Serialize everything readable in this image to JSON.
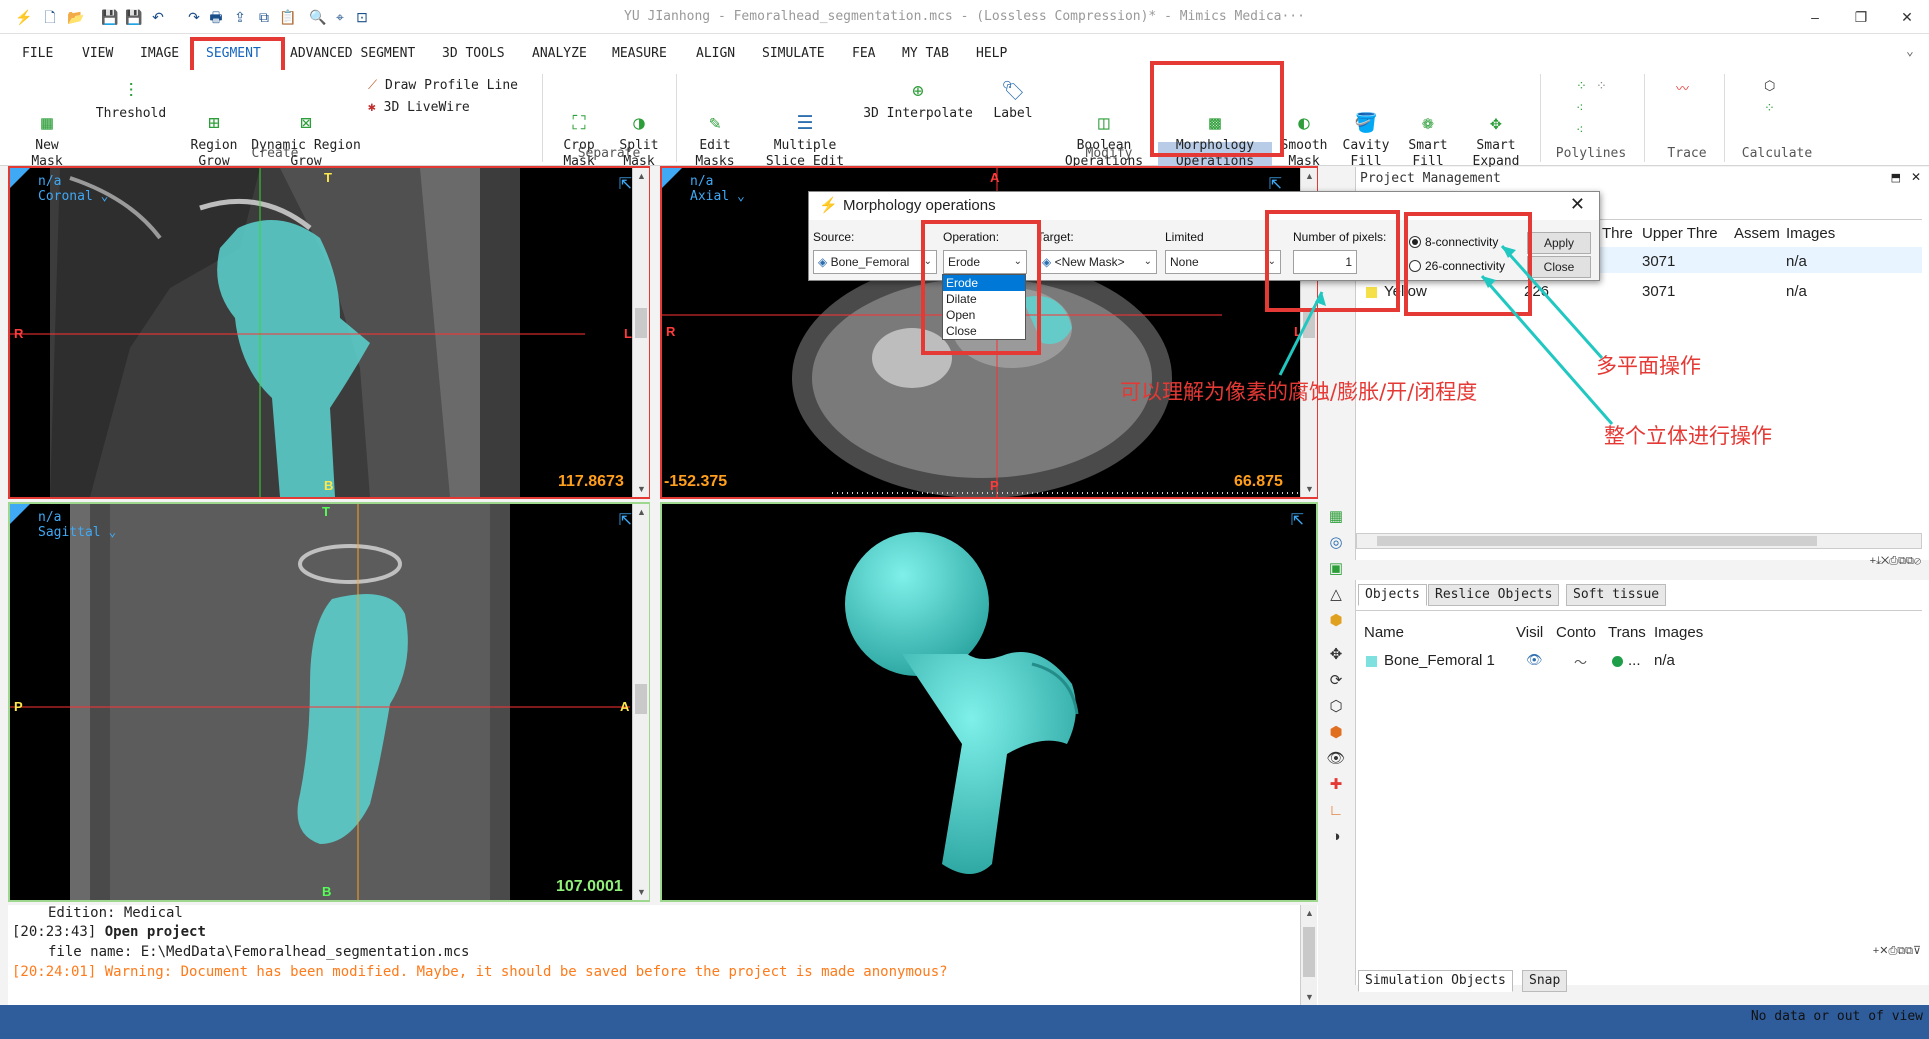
{
  "titlebar": {
    "title": "YU JIanhong - Femoralhead_segmentation.mcs -  (Lossless Compression)* - Mimics Medica···",
    "minimize": "–",
    "restore": "❐",
    "close": "✕"
  },
  "menu": [
    "FILE",
    "VIEW",
    "IMAGE",
    "SEGMENT",
    "ADVANCED SEGMENT",
    "3D TOOLS",
    "ANALYZE",
    "MEASURE",
    "ALIGN",
    "SIMULATE",
    "FEA",
    "MY TAB",
    "HELP"
  ],
  "ribbon": {
    "new_mask": "New\nMask",
    "threshold": "Threshold",
    "region_grow": "Region\nGrow",
    "dynamic_region_grow": "Dynamic Region\nGrow",
    "draw_profile_line": "Draw Profile Line",
    "live_wire": "3D LiveWire",
    "group_create": "Create",
    "crop_mask": "Crop\nMask",
    "split_mask": "Split\nMask",
    "group_separate": "Separate",
    "edit_masks": "Edit\nMasks",
    "multiple_slice_edit": "Multiple\nSlice Edit",
    "interpolate_3d": "3D Interpolate",
    "label": "Label",
    "boolean_operations": "Boolean\nOperations",
    "morphology_operations": "Morphology\nOperations",
    "smooth_mask": "Smooth\nMask",
    "cavity_fill": "Cavity\nFill",
    "smart_fill": "Smart\nFill",
    "smart_expand": "Smart\nExpand",
    "group_modify": "Modify",
    "group_polylines": "Polylines",
    "group_trace": "Trace",
    "group_calculate": "Calculate"
  },
  "viewports": {
    "coronal": {
      "name": "n/a",
      "view": "Coronal",
      "value": "117.8673",
      "top": "T",
      "bottom": "B",
      "left": "R",
      "right": "L"
    },
    "axial": {
      "name": "n/a",
      "view": "Axial",
      "value_left": "-152.375",
      "value_right": "66.875",
      "top": "A",
      "bottom": "P",
      "left": "R",
      "right": "L"
    },
    "sagittal": {
      "name": "n/a",
      "view": "Sagittal",
      "value": "107.0001",
      "top": "T",
      "bottom": "B",
      "left": "P",
      "right": "A"
    }
  },
  "dialog": {
    "title": "Morphology operations",
    "source_label": "Source:",
    "source_value": "Bone_Femoral",
    "operation_label": "Operation:",
    "operation_value": "Erode",
    "operation_options": [
      "Erode",
      "Dilate",
      "Open",
      "Close"
    ],
    "target_label": "Target:",
    "target_value": "<New Mask>",
    "limited_label": "Limited",
    "limited_value": "None",
    "pixels_label": "Number of pixels:",
    "pixels_value": "1",
    "connectivity_8": "8-connectivity",
    "connectivity_26": "26-connectivity",
    "apply": "Apply",
    "close": "Close"
  },
  "annotations": {
    "pixels_note": "可以理解为像素的腐蚀/膨胀/开/闭程度",
    "multi_plane": "多平面操作",
    "whole_volume": "整个立体进行操作"
  },
  "project_panel": {
    "title": "Project Management",
    "columns": [
      "Thre",
      "Upper Thre",
      "Assem",
      "Images"
    ],
    "rows": [
      {
        "name": "",
        "lower": "",
        "upper": "3071",
        "images": "n/a",
        "color": "#7fe0e0"
      },
      {
        "name": "Yellow",
        "lower": "226",
        "upper": "3071",
        "images": "n/a",
        "color": "#f5e04a"
      }
    ]
  },
  "objects_panel": {
    "tabs": [
      "Objects",
      "Reslice Objects",
      "Soft tissue"
    ],
    "columns": [
      "Name",
      "Visil",
      "Conto",
      "Trans",
      "Images"
    ],
    "rows": [
      {
        "name": "Bone_Femoral 1",
        "trans": "...",
        "images": "n/a",
        "color": "#7fe0e0"
      }
    ],
    "bottom_tabs": [
      "Simulation Objects",
      "Snap"
    ]
  },
  "log": {
    "line1": "Edition: Medical",
    "line2_time": "[20:23:43]",
    "line2_msg": "Open project",
    "line3": "file name: E:\\MedData\\Femoralhead_segmentation.mcs",
    "line4": "[20:24:01] Warning: Document has been modified. Maybe, it should be saved before the project is made anonymous?"
  },
  "status": {
    "text": "No data or out of view"
  },
  "colors": {
    "accent": "#1565c0",
    "highlight": "#e53935",
    "mask": "#5bd4d0",
    "status_bar": "#2f5d9c"
  }
}
